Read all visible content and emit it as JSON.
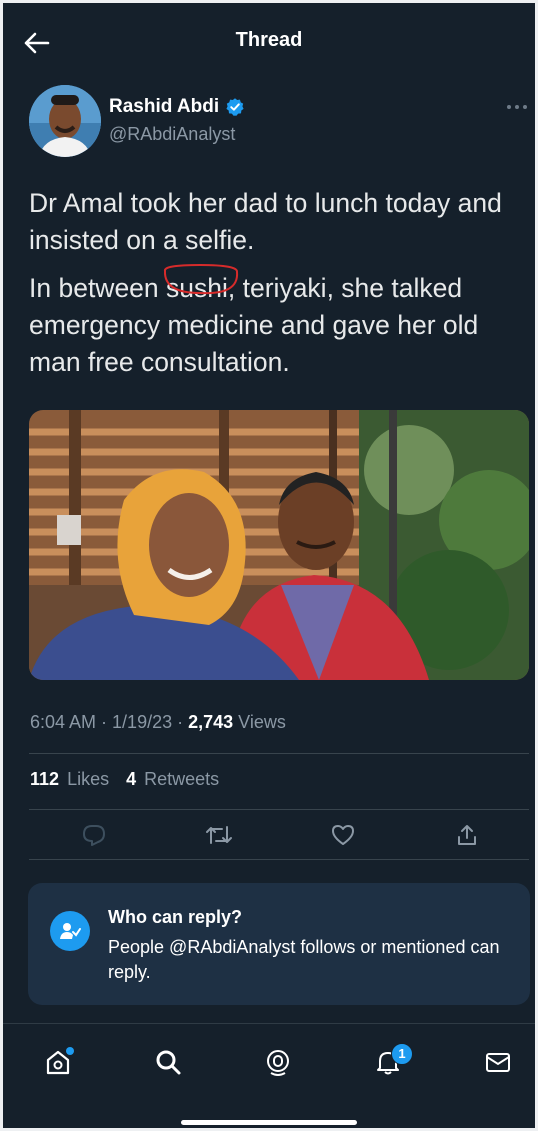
{
  "header": {
    "title": "Thread"
  },
  "tweet": {
    "author_name": "Rashid Abdi",
    "author_handle": "@RAbdiAnalyst",
    "paragraph1": "Dr Amal took her dad to lunch today and insisted on a selfie.",
    "paragraph2_before": "In between ",
    "paragraph2_circled": "sushi",
    "paragraph2_after": ", teriyaki, she talked emergency medicine and gave her old man free consultation.",
    "time": "6:04 AM",
    "date": "1/19/23",
    "views_count": "2,743",
    "views_label": "Views",
    "likes_count": "112",
    "likes_label": "Likes",
    "retweets_count": "4",
    "retweets_label": "Retweets"
  },
  "reply_card": {
    "title": "Who can reply?",
    "description": "People @RAbdiAnalyst follows or mentioned can reply."
  },
  "tabbar": {
    "notifications_badge": "1"
  },
  "colors": {
    "background": "#15202b",
    "accent": "#1d9bf0",
    "muted": "#8b98a5",
    "annotation": "#d62b2b"
  },
  "icons": [
    "back-arrow-icon",
    "verified-badge-icon",
    "more-icon",
    "reply-icon",
    "retweet-icon",
    "like-icon",
    "share-icon",
    "who-can-reply-icon",
    "home-icon",
    "search-icon",
    "spaces-icon",
    "notifications-icon",
    "messages-icon"
  ]
}
